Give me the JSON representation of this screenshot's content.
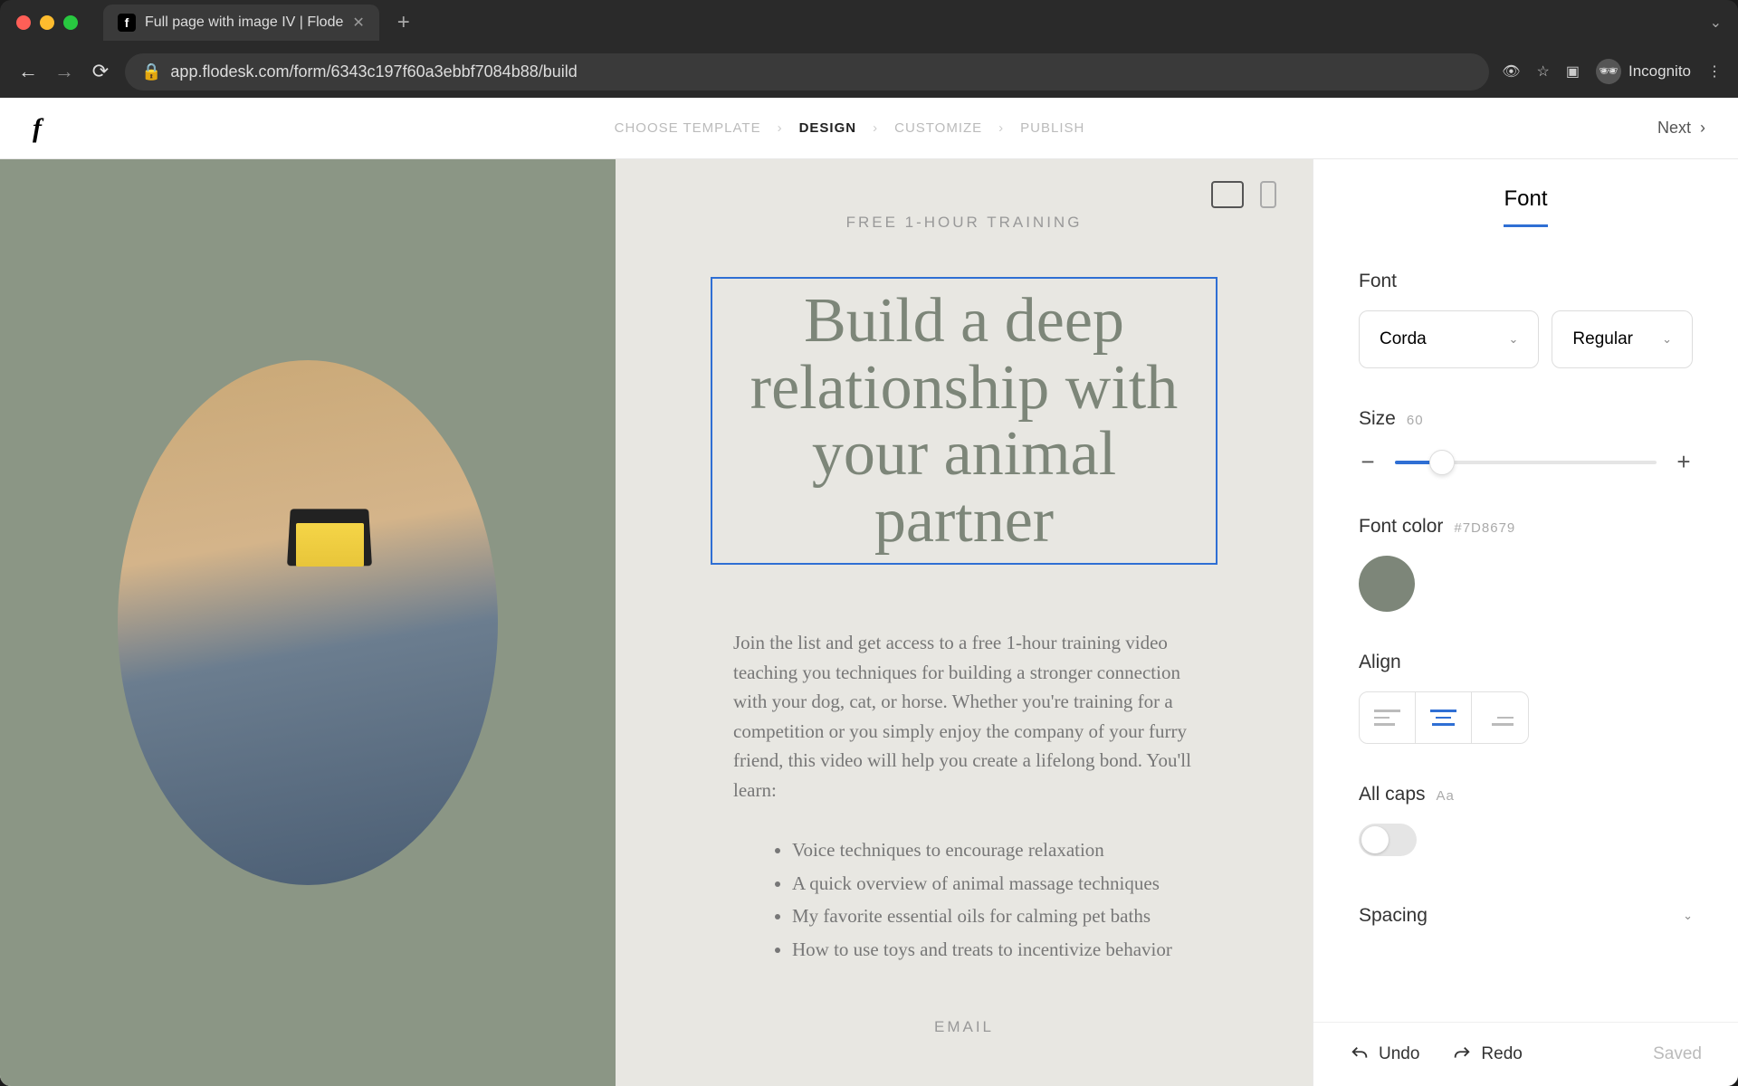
{
  "browser": {
    "tab_title": "Full page with image IV | Flode",
    "url": "app.flodesk.com/form/6343c197f60a3ebbf7084b88/build",
    "incognito_label": "Incognito"
  },
  "header": {
    "steps": [
      "CHOOSE TEMPLATE",
      "DESIGN",
      "CUSTOMIZE",
      "PUBLISH"
    ],
    "active_step": "DESIGN",
    "next_label": "Next"
  },
  "canvas": {
    "eyebrow": "FREE 1-HOUR TRAINING",
    "headline": "Build a deep relationship with your animal partner",
    "body": "Join the list and get access to a free 1-hour training video teaching you techniques for building a stronger connection with your dog, cat, or horse. Whether you're training for a competition or you simply enjoy the company of your furry friend, this video will help you create a lifelong bond. You'll learn:",
    "bullets": [
      "Voice techniques to encourage relaxation",
      "A quick overview of animal massage techniques",
      "My favorite essential oils for calming pet baths",
      "How to use toys and treats to incentivize behavior"
    ],
    "email_label": "EMAIL"
  },
  "panel": {
    "title": "Font",
    "font_label": "Font",
    "font_family": "Corda",
    "font_weight": "Regular",
    "size_label": "Size",
    "size_value": "60",
    "color_label": "Font color",
    "color_hex": "#7D8679",
    "align_label": "Align",
    "allcaps_label": "All caps",
    "allcaps_hint": "Aa",
    "spacing_label": "Spacing",
    "undo_label": "Undo",
    "redo_label": "Redo",
    "saved_label": "Saved"
  }
}
